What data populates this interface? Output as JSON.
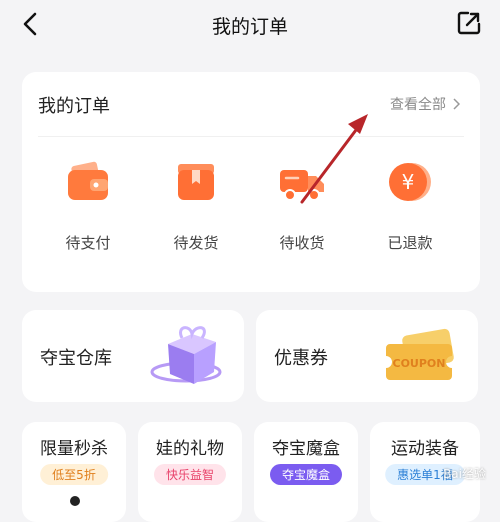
{
  "header": {
    "title": "我的订单",
    "back_icon": "chevron-left-icon",
    "share_icon": "share-external-icon"
  },
  "orders": {
    "title": "我的订单",
    "view_all": "查看全部",
    "items": [
      {
        "label": "待支付",
        "icon": "wallet-icon"
      },
      {
        "label": "待发货",
        "icon": "package-icon"
      },
      {
        "label": "待收货",
        "icon": "truck-icon"
      },
      {
        "label": "已退款",
        "icon": "yen-coin-icon"
      }
    ]
  },
  "shortcuts": {
    "warehouse": {
      "label": "夺宝仓库",
      "icon": "gift-box-icon"
    },
    "coupon": {
      "label": "优惠券",
      "icon": "coupon-ticket-icon",
      "icon_text": "COUPON"
    }
  },
  "categories": [
    {
      "title": "限量秒杀",
      "tag": "低至5折"
    },
    {
      "title": "娃的礼物",
      "tag": "快乐益智"
    },
    {
      "title": "夺宝魔盒",
      "tag": "夺宝魔盒"
    },
    {
      "title": "运动装备",
      "tag": "惠选单1福"
    }
  ],
  "watermark": "Bai经验",
  "colors": {
    "accent_orange": "#ff6a2b",
    "annotation_arrow": "#b8262a",
    "coupon_gold": "#f4b942",
    "magic_purple": "#7b5cf0"
  }
}
